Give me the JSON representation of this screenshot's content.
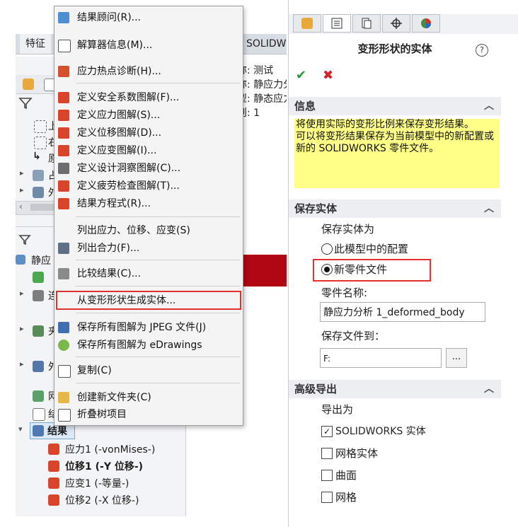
{
  "cmd_tabs": {
    "features": "特征",
    "solidworks": "SOLIDWO"
  },
  "study_props": {
    "line1": "称: 测试",
    "line2": "称: 静应力分",
    "line3": "型: 静态应力",
    "line4": "则: 1"
  },
  "tree_frag": {
    "a": "上",
    "b": "右",
    "c": "原",
    "d": "占",
    "e": "外",
    "static": "静应",
    "conn": "连",
    "fix": "夹",
    "ext": "外",
    "mesh": "网",
    "res": "结"
  },
  "menu": {
    "items": [
      "结果顾问(R)...",
      "解算器信息(M)...",
      "应力热点诊断(H)...",
      "定义安全系数图解(F)...",
      "定义应力图解(S)...",
      "定义位移图解(D)...",
      "定义应变图解(I)...",
      "定义设计洞察图解(C)...",
      "定义疲劳检查图解(T)...",
      "结果方程式(R)...",
      "列出应力、位移、应变(S)",
      "列出合力(F)...",
      "比较结果(C)...",
      "从变形形状生成实体...",
      "保存所有图解为 JPEG 文件(J)",
      "保存所有图解为 eDrawings",
      "复制(C)",
      "创建新文件夹(C)",
      "折叠树项目"
    ]
  },
  "results_tree": {
    "folder": "结果",
    "items": [
      "应力1 (-vonMises-)",
      "位移1 (-Y 位移-)",
      "应变1 (-等量-)",
      "位移2 (-X 位移-)"
    ]
  },
  "pm": {
    "title": "变形形状的实体",
    "help": "?",
    "ok": "✔",
    "cancel": "✖",
    "info": {
      "header": "信息",
      "text1": "将使用实际的变形比例来保存变形结果。",
      "text2": "可以将变形结果保存为当前模型中的新配置或新的 SOLIDWORKS 零件文件。"
    },
    "save": {
      "header": "保存实体",
      "save_as": "保存实体为",
      "opt_config": "此模型中的配置",
      "opt_part": "新零件文件",
      "part_name_label": "零件名称:",
      "part_name_value": "静应力分析 1_deformed_body",
      "save_to_label": "保存文件到：",
      "save_to_value": "F:",
      "browse": "..."
    },
    "adv": {
      "header": "高级导出",
      "export_as": "导出为",
      "opts": [
        "SOLIDWORKS 实体",
        "网格实体",
        "曲面",
        "网格"
      ],
      "checked": [
        true,
        false,
        false,
        false
      ]
    }
  },
  "colors": {
    "highlight": "#e0312e",
    "info_bg": "#ffff88",
    "ok": "#2a9d3a",
    "cancel": "#d0202a"
  }
}
